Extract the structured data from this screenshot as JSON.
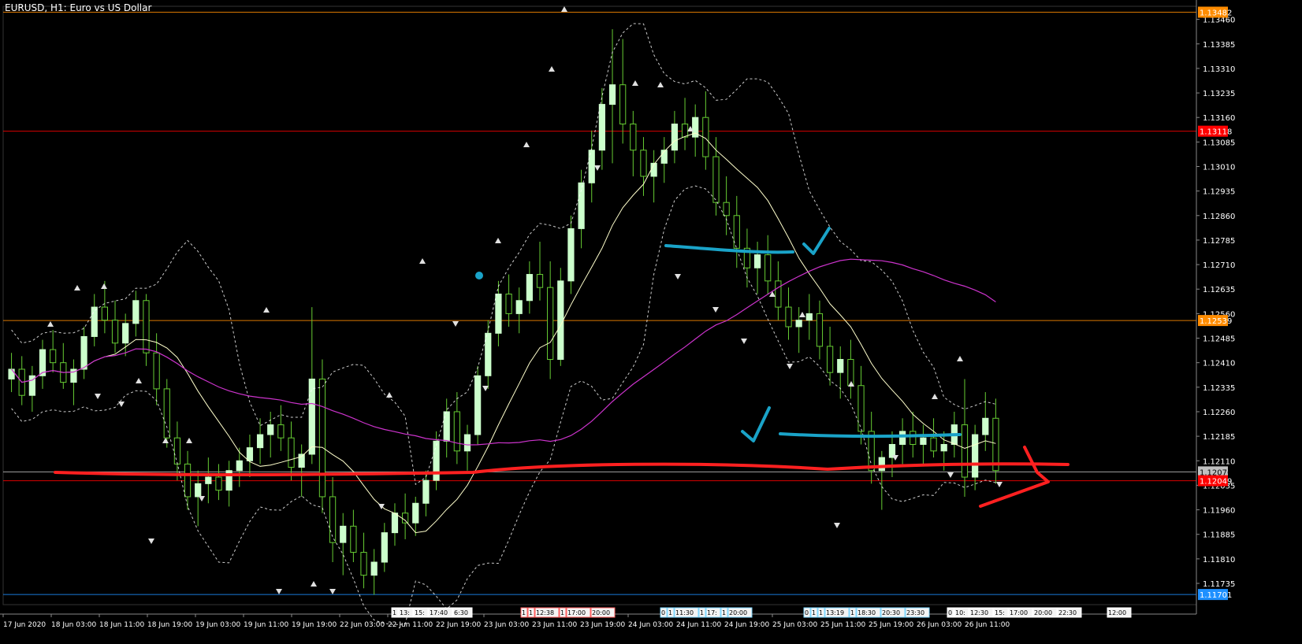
{
  "window": {
    "title": "EURUSD, H1:  Euro vs US Dollar"
  },
  "price_axis": {
    "ticks": [
      "1.13460",
      "1.13385",
      "1.13310",
      "1.13235",
      "1.13160",
      "1.13085",
      "1.13010",
      "1.12935",
      "1.12860",
      "1.12785",
      "1.12710",
      "1.12635",
      "1.12560",
      "1.12485",
      "1.12410",
      "1.12335",
      "1.12260",
      "1.12185",
      "1.12110",
      "1.12035",
      "1.11960",
      "1.11885",
      "1.11810",
      "1.11735"
    ],
    "tick_values": [
      1.1346,
      1.13385,
      1.1331,
      1.13235,
      1.1316,
      1.13085,
      1.1301,
      1.12935,
      1.1286,
      1.12785,
      1.1271,
      1.12635,
      1.1256,
      1.12485,
      1.1241,
      1.12335,
      1.1226,
      1.12185,
      1.1211,
      1.12035,
      1.1196,
      1.11885,
      1.1181,
      1.11735
    ],
    "labels": [
      {
        "text": "1.13482",
        "value": 1.13482,
        "color": "#ff8c00"
      },
      {
        "text": "1.13118",
        "value": 1.13118,
        "color": "#ff0000"
      },
      {
        "text": "1.12539",
        "value": 1.12539,
        "color": "#ff8c00"
      },
      {
        "text": "1.12076",
        "value": 1.12076,
        "color": "#c0c0c0"
      },
      {
        "text": "1.12049",
        "value": 1.12049,
        "color": "#ff0000"
      },
      {
        "text": "1.11701",
        "value": 1.11701,
        "color": "#1e90ff"
      }
    ]
  },
  "time_axis": {
    "labels": [
      "17 Jun 2020",
      "18 Jun 03:00",
      "18 Jun 11:00",
      "18 Jun 19:00",
      "19 Jun 03:00",
      "19 Jun 11:00",
      "19 Jun 19:00",
      "22 Jun 03:00",
      "22 Jun 11:00",
      "22 Jun 19:00",
      "23 Jun 03:00",
      "23 Jun 11:00",
      "23 Jun 19:00",
      "24 Jun 03:00",
      "24 Jun 11:00",
      "24 Jun 19:00",
      "25 Jun 03:00",
      "25 Jun 11:00",
      "25 Jun 19:00",
      "26 Jun 03:00",
      "26 Jun 11:00"
    ]
  },
  "markers": {
    "groups": [
      {
        "items": [
          "1",
          "13:",
          "15:",
          "17:40",
          "6:30"
        ],
        "color": "#ffffff"
      },
      {
        "items": [
          "1",
          "1",
          "12:38",
          "1",
          "17:00",
          "20:00"
        ],
        "color": "#ff6060"
      },
      {
        "items": [
          "0",
          "1",
          "11:30",
          "1",
          "17:",
          "1",
          "20:00"
        ],
        "color": "#80d8ff"
      },
      {
        "items": [
          "0",
          "1",
          "1",
          "13:19",
          "1",
          "18:30",
          "20:30",
          "23:30"
        ],
        "color": "#80d8ff"
      },
      {
        "items": [
          "0",
          "10:",
          "12:30",
          "15:",
          "17:00",
          "20:00",
          "22:30"
        ],
        "color": "#ffffff"
      },
      {
        "items": [
          "12:00"
        ],
        "color": "#ffffff"
      }
    ]
  },
  "chart_data": {
    "type": "candlestick",
    "symbol": "EURUSD",
    "timeframe": "H1",
    "ylim": [
      1.1167,
      1.135
    ],
    "grid": false,
    "candles": [
      [
        1.1236,
        1.1244,
        1.1232,
        1.1239
      ],
      [
        1.1239,
        1.1243,
        1.1228,
        1.1231
      ],
      [
        1.1231,
        1.124,
        1.1226,
        1.1237
      ],
      [
        1.1237,
        1.1248,
        1.1233,
        1.1245
      ],
      [
        1.1245,
        1.1251,
        1.1238,
        1.1241
      ],
      [
        1.1241,
        1.1247,
        1.1233,
        1.1235
      ],
      [
        1.1235,
        1.1242,
        1.1228,
        1.1239
      ],
      [
        1.1239,
        1.1252,
        1.1236,
        1.1249
      ],
      [
        1.1249,
        1.1262,
        1.1246,
        1.1258
      ],
      [
        1.1258,
        1.1266,
        1.125,
        1.1254
      ],
      [
        1.1254,
        1.126,
        1.1244,
        1.1247
      ],
      [
        1.1247,
        1.1256,
        1.1243,
        1.1253
      ],
      [
        1.1253,
        1.1263,
        1.1249,
        1.126
      ],
      [
        1.126,
        1.1262,
        1.124,
        1.1244
      ],
      [
        1.1244,
        1.125,
        1.1228,
        1.1233
      ],
      [
        1.1233,
        1.1236,
        1.1215,
        1.1218
      ],
      [
        1.1218,
        1.1223,
        1.1205,
        1.121
      ],
      [
        1.121,
        1.1214,
        1.1196,
        1.12
      ],
      [
        1.12,
        1.1208,
        1.1191,
        1.1204
      ],
      [
        1.1204,
        1.1212,
        1.1198,
        1.1206
      ],
      [
        1.1206,
        1.121,
        1.1199,
        1.1202
      ],
      [
        1.1202,
        1.1211,
        1.1197,
        1.1208
      ],
      [
        1.1208,
        1.1215,
        1.1203,
        1.1211
      ],
      [
        1.1211,
        1.1219,
        1.1206,
        1.1215
      ],
      [
        1.1215,
        1.1224,
        1.121,
        1.1219
      ],
      [
        1.1219,
        1.1226,
        1.1212,
        1.1222
      ],
      [
        1.1222,
        1.1228,
        1.1214,
        1.1218
      ],
      [
        1.1218,
        1.1223,
        1.1205,
        1.1209
      ],
      [
        1.1209,
        1.1216,
        1.12,
        1.1213
      ],
      [
        1.1213,
        1.1258,
        1.121,
        1.1236
      ],
      [
        1.1236,
        1.1242,
        1.1195,
        1.12
      ],
      [
        1.12,
        1.1206,
        1.118,
        1.1186
      ],
      [
        1.1186,
        1.1195,
        1.1176,
        1.1191
      ],
      [
        1.1191,
        1.1196,
        1.118,
        1.1183
      ],
      [
        1.1183,
        1.1189,
        1.1172,
        1.1176
      ],
      [
        1.1176,
        1.1184,
        1.117,
        1.118
      ],
      [
        1.118,
        1.1192,
        1.1177,
        1.1189
      ],
      [
        1.1189,
        1.1198,
        1.1185,
        1.1195
      ],
      [
        1.1195,
        1.1201,
        1.1187,
        1.1192
      ],
      [
        1.1192,
        1.12,
        1.1188,
        1.1198
      ],
      [
        1.1198,
        1.1208,
        1.1194,
        1.1205
      ],
      [
        1.1205,
        1.122,
        1.1202,
        1.1217
      ],
      [
        1.1217,
        1.123,
        1.1212,
        1.1226
      ],
      [
        1.1226,
        1.1232,
        1.121,
        1.1214
      ],
      [
        1.1214,
        1.1222,
        1.1208,
        1.1219
      ],
      [
        1.1219,
        1.124,
        1.1216,
        1.1237
      ],
      [
        1.1237,
        1.1254,
        1.1233,
        1.125
      ],
      [
        1.125,
        1.1266,
        1.1246,
        1.1262
      ],
      [
        1.1262,
        1.1268,
        1.1252,
        1.1256
      ],
      [
        1.1256,
        1.1264,
        1.125,
        1.126
      ],
      [
        1.126,
        1.1272,
        1.1256,
        1.1268
      ],
      [
        1.1268,
        1.1278,
        1.126,
        1.1264
      ],
      [
        1.1264,
        1.1272,
        1.1236,
        1.1242
      ],
      [
        1.1242,
        1.127,
        1.124,
        1.1266
      ],
      [
        1.1266,
        1.1286,
        1.1262,
        1.1282
      ],
      [
        1.1282,
        1.13,
        1.1276,
        1.1296
      ],
      [
        1.1296,
        1.1312,
        1.129,
        1.1306
      ],
      [
        1.1306,
        1.1325,
        1.13,
        1.132
      ],
      [
        1.132,
        1.1343,
        1.1302,
        1.1326
      ],
      [
        1.1326,
        1.134,
        1.1308,
        1.1314
      ],
      [
        1.1314,
        1.1318,
        1.1298,
        1.1306
      ],
      [
        1.1306,
        1.131,
        1.1292,
        1.1298
      ],
      [
        1.1298,
        1.1306,
        1.129,
        1.1302
      ],
      [
        1.1302,
        1.131,
        1.1296,
        1.1306
      ],
      [
        1.1306,
        1.1318,
        1.1302,
        1.1314
      ],
      [
        1.1314,
        1.1322,
        1.1306,
        1.131
      ],
      [
        1.131,
        1.132,
        1.1304,
        1.1316
      ],
      [
        1.1316,
        1.1324,
        1.13,
        1.1304
      ],
      [
        1.1304,
        1.131,
        1.1286,
        1.129
      ],
      [
        1.129,
        1.1298,
        1.128,
        1.1286
      ],
      [
        1.1286,
        1.1292,
        1.127,
        1.1276
      ],
      [
        1.1276,
        1.1282,
        1.1264,
        1.127
      ],
      [
        1.127,
        1.1278,
        1.1262,
        1.1274
      ],
      [
        1.1274,
        1.128,
        1.1262,
        1.1266
      ],
      [
        1.1266,
        1.1272,
        1.1254,
        1.1258
      ],
      [
        1.1258,
        1.1264,
        1.1248,
        1.1252
      ],
      [
        1.1252,
        1.1258,
        1.1244,
        1.1254
      ],
      [
        1.1254,
        1.1262,
        1.1248,
        1.1256
      ],
      [
        1.1256,
        1.126,
        1.1242,
        1.1246
      ],
      [
        1.1246,
        1.1252,
        1.1234,
        1.1238
      ],
      [
        1.1238,
        1.1246,
        1.123,
        1.1242
      ],
      [
        1.1242,
        1.1248,
        1.123,
        1.1234
      ],
      [
        1.1234,
        1.124,
        1.1216,
        1.122
      ],
      [
        1.122,
        1.1226,
        1.1204,
        1.1208
      ],
      [
        1.1208,
        1.1214,
        1.1196,
        1.1212
      ],
      [
        1.1212,
        1.122,
        1.1206,
        1.1216
      ],
      [
        1.1216,
        1.1224,
        1.121,
        1.122
      ],
      [
        1.122,
        1.1226,
        1.1212,
        1.1216
      ],
      [
        1.1216,
        1.1222,
        1.121,
        1.1218
      ],
      [
        1.1218,
        1.1224,
        1.1212,
        1.1214
      ],
      [
        1.1214,
        1.122,
        1.1208,
        1.1216
      ],
      [
        1.1216,
        1.1226,
        1.1212,
        1.1222
      ],
      [
        1.1222,
        1.1236,
        1.12,
        1.1206
      ],
      [
        1.1206,
        1.1222,
        1.1202,
        1.1219
      ],
      [
        1.1219,
        1.1232,
        1.1214,
        1.1224
      ],
      [
        1.1224,
        1.123,
        1.1204,
        1.1208
      ]
    ],
    "indicators": [
      {
        "name": "Bollinger upper",
        "style": "dotted",
        "color": "#ffffff"
      },
      {
        "name": "Bollinger lower",
        "style": "dotted",
        "color": "#ffffff"
      },
      {
        "name": "MA fast",
        "style": "solid",
        "color": "#ffffcc"
      },
      {
        "name": "MA slow",
        "style": "solid",
        "color": "#cc33cc"
      }
    ]
  },
  "annotations": {
    "support_line_color": "#ff0000",
    "drawing_color_red": "#ff2020",
    "drawing_color_blue": "#1aa3c8"
  },
  "colors": {
    "background": "#000000",
    "candle_up": "#ccffcc",
    "candle_down": "#000000",
    "wick": "#66cc33",
    "axis_text": "#ffffff"
  }
}
